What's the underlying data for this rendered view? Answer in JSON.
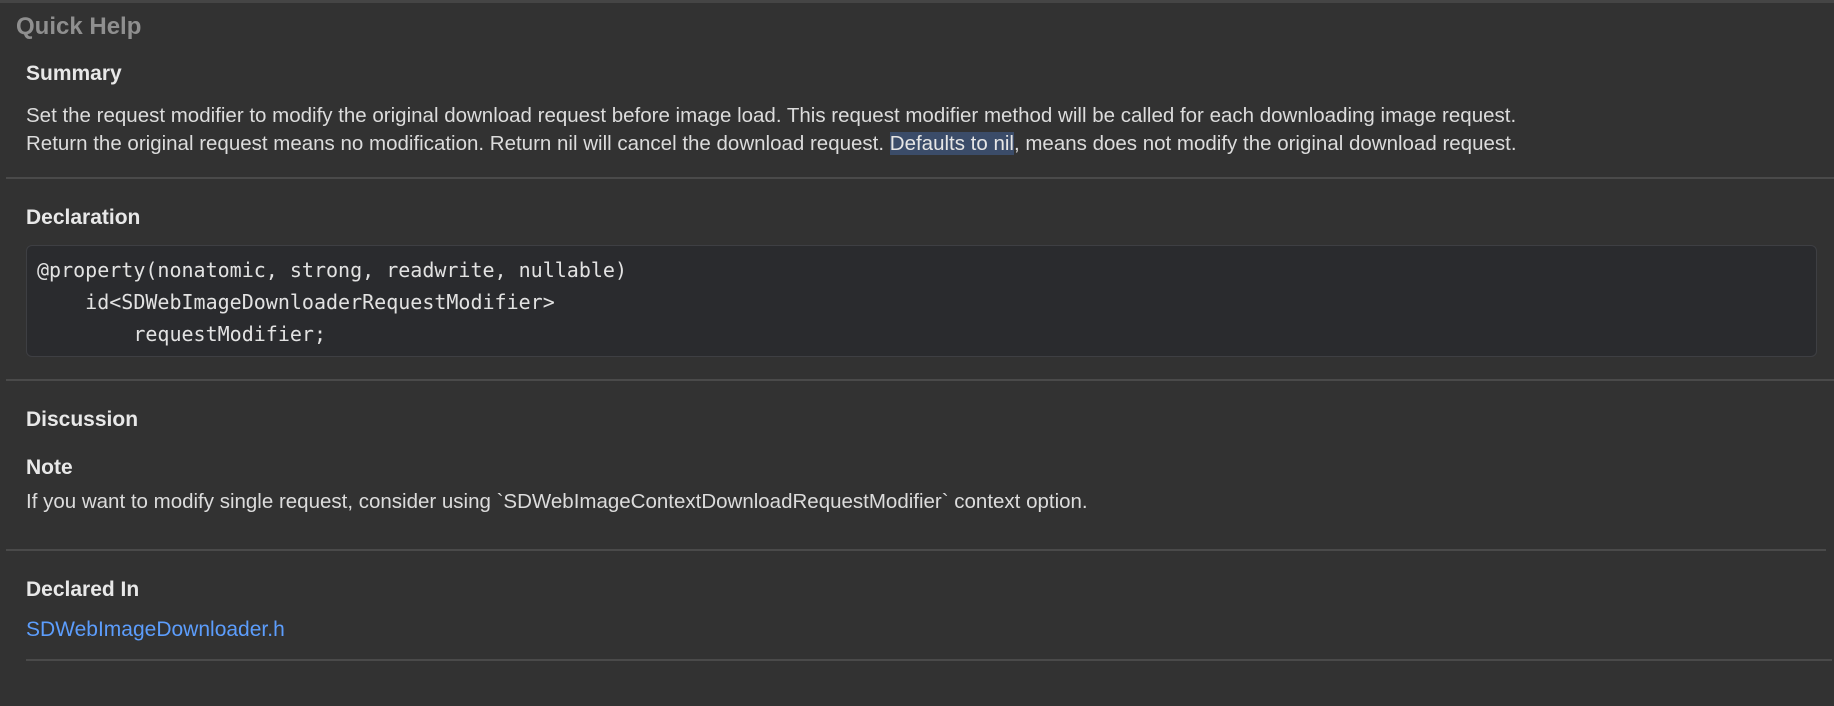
{
  "panel": {
    "title": "Quick Help"
  },
  "summary": {
    "heading": "Summary",
    "line1": "Set the request modifier to modify the original download request before image load. This request modifier method will be called for each downloading image request.",
    "line2_before": "Return the original request means no modification. Return nil will cancel the download request. ",
    "line2_highlight": "Defaults to nil",
    "line2_after": ", means does not modify the original download request."
  },
  "declaration": {
    "heading": "Declaration",
    "code_lines": [
      "@property(nonatomic, strong, readwrite, nullable)",
      "    id<SDWebImageDownloaderRequestModifier>",
      "        requestModifier;"
    ]
  },
  "discussion": {
    "heading": "Discussion",
    "note_heading": "Note",
    "note_text": "If you want to modify single request, consider using `SDWebImageContextDownloadRequestModifier` context option."
  },
  "declared_in": {
    "heading": "Declared In",
    "link_text": "SDWebImageDownloader.h",
    "link_color": "#5c9dfc"
  },
  "colors": {
    "background": "#323232",
    "highlight": "#3b4c69",
    "code_background": "#2a2b2e"
  }
}
